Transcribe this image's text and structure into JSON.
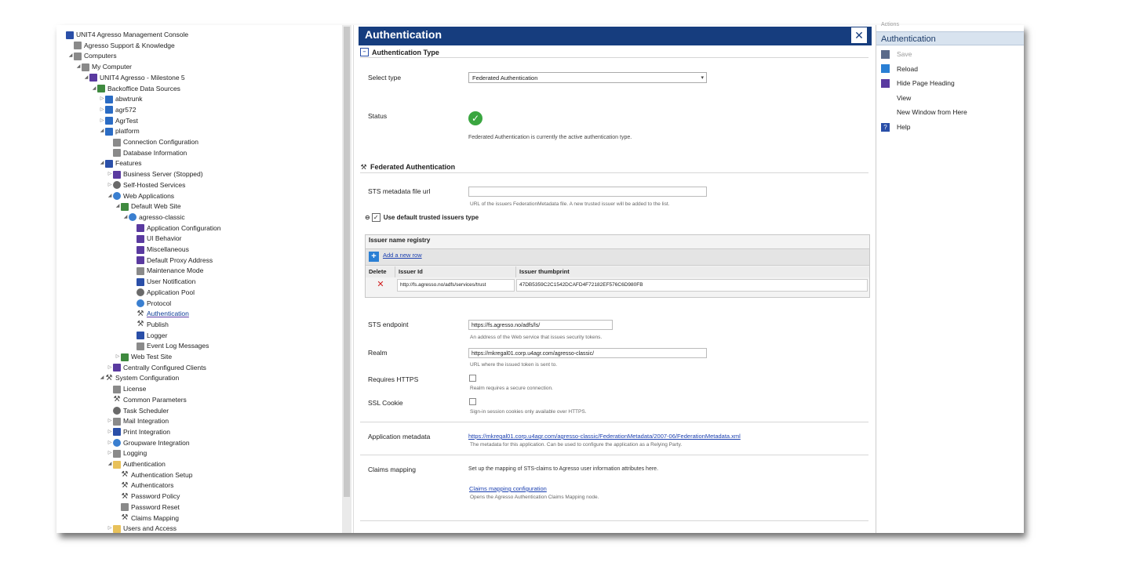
{
  "tree": [
    {
      "label": "UNIT4 Agresso Management Console",
      "level": 0,
      "tw": "",
      "icon": "console-icon",
      "ic": "blue"
    },
    {
      "label": "Agresso Support & Knowledge",
      "level": 1,
      "tw": "",
      "icon": "support-icon",
      "ic": "gray"
    },
    {
      "label": "Computers",
      "level": 1,
      "tw": "◢",
      "icon": "computers-icon",
      "ic": "gray"
    },
    {
      "label": "My Computer",
      "level": 2,
      "tw": "◢",
      "icon": "computer-icon",
      "ic": "gray"
    },
    {
      "label": "UNIT4 Agresso - Milestone 5",
      "level": 3,
      "tw": "◢",
      "icon": "agresso-icon",
      "ic": "purple"
    },
    {
      "label": "Backoffice Data Sources",
      "level": 4,
      "tw": "◢",
      "icon": "datasources-icon",
      "ic": "green"
    },
    {
      "label": "abwtrunk",
      "level": 5,
      "tw": "▷",
      "icon": "database-icon",
      "ic": "db"
    },
    {
      "label": "agr572",
      "level": 5,
      "tw": "▷",
      "icon": "database-icon",
      "ic": "db"
    },
    {
      "label": "AgrTest",
      "level": 5,
      "tw": "▷",
      "icon": "database-icon",
      "ic": "db"
    },
    {
      "label": "platform",
      "level": 5,
      "tw": "◢",
      "icon": "database-icon",
      "ic": "db"
    },
    {
      "label": "Connection Configuration",
      "level": 6,
      "tw": "",
      "icon": "connection-icon",
      "ic": "gray"
    },
    {
      "label": "Database Information",
      "level": 6,
      "tw": "",
      "icon": "info-icon",
      "ic": "gray"
    },
    {
      "label": "Features",
      "level": 5,
      "tw": "◢",
      "icon": "features-icon",
      "ic": "blue"
    },
    {
      "label": "Business Server (Stopped)",
      "level": 6,
      "tw": "▷",
      "icon": "server-icon",
      "ic": "purple"
    },
    {
      "label": "Self-Hosted Services",
      "level": 6,
      "tw": "▷",
      "icon": "services-icon",
      "ic": "gear"
    },
    {
      "label": "Web Applications",
      "level": 6,
      "tw": "◢",
      "icon": "webapps-icon",
      "ic": "globe"
    },
    {
      "label": "Default Web Site",
      "level": 7,
      "tw": "◢",
      "icon": "website-icon",
      "ic": "green"
    },
    {
      "label": "agresso-classic",
      "level": 8,
      "tw": "◢",
      "icon": "globe-icon",
      "ic": "globe"
    },
    {
      "label": "Application Configuration",
      "level": 9,
      "tw": "",
      "icon": "config-icon",
      "ic": "purple"
    },
    {
      "label": "UI Behavior",
      "level": 9,
      "tw": "",
      "icon": "ui-icon",
      "ic": "purple"
    },
    {
      "label": "Miscellaneous",
      "level": 9,
      "tw": "",
      "icon": "misc-icon",
      "ic": "purple"
    },
    {
      "label": "Default Proxy Address",
      "level": 9,
      "tw": "",
      "icon": "proxy-icon",
      "ic": "purple"
    },
    {
      "label": "Maintenance Mode",
      "level": 9,
      "tw": "",
      "icon": "maintenance-icon",
      "ic": "gray"
    },
    {
      "label": "User Notification",
      "level": 9,
      "tw": "",
      "icon": "notification-icon",
      "ic": "blue"
    },
    {
      "label": "Application Pool",
      "level": 9,
      "tw": "",
      "icon": "pool-icon",
      "ic": "gear"
    },
    {
      "label": "Protocol",
      "level": 9,
      "tw": "",
      "icon": "protocol-icon",
      "ic": "globe"
    },
    {
      "label": "Authentication",
      "level": 9,
      "tw": "",
      "icon": "authentication-icon",
      "ic": "tool",
      "selected": true
    },
    {
      "label": "Publish",
      "level": 9,
      "tw": "",
      "icon": "publish-icon",
      "ic": "tool"
    },
    {
      "label": "Logger",
      "level": 9,
      "tw": "",
      "icon": "logger-icon",
      "ic": "blue"
    },
    {
      "label": "Event Log Messages",
      "level": 9,
      "tw": "",
      "icon": "eventlog-icon",
      "ic": "gray"
    },
    {
      "label": "Web Test Site",
      "level": 7,
      "tw": "▷",
      "icon": "website-icon",
      "ic": "green"
    },
    {
      "label": "Centrally Configured Clients",
      "level": 6,
      "tw": "▷",
      "icon": "clients-icon",
      "ic": "purple"
    },
    {
      "label": "System Configuration",
      "level": 5,
      "tw": "◢",
      "icon": "sysconfig-icon",
      "ic": "tool"
    },
    {
      "label": "License",
      "level": 6,
      "tw": "",
      "icon": "license-icon",
      "ic": "gray"
    },
    {
      "label": "Common Parameters",
      "level": 6,
      "tw": "",
      "icon": "parameters-icon",
      "ic": "tool"
    },
    {
      "label": "Task Scheduler",
      "level": 6,
      "tw": "",
      "icon": "clock-icon",
      "ic": "gear"
    },
    {
      "label": "Mail Integration",
      "level": 6,
      "tw": "▷",
      "icon": "mail-icon",
      "ic": "gray"
    },
    {
      "label": "Print Integration",
      "level": 6,
      "tw": "▷",
      "icon": "print-icon",
      "ic": "blue"
    },
    {
      "label": "Groupware Integration",
      "level": 6,
      "tw": "▷",
      "icon": "groupware-icon",
      "ic": "globe"
    },
    {
      "label": "Logging",
      "level": 6,
      "tw": "▷",
      "icon": "logging-icon",
      "ic": "gray"
    },
    {
      "label": "Authentication",
      "level": 6,
      "tw": "◢",
      "icon": "folder-icon",
      "ic": "folder"
    },
    {
      "label": "Authentication Setup",
      "level": 7,
      "tw": "",
      "icon": "setup-icon",
      "ic": "tool"
    },
    {
      "label": "Authenticators",
      "level": 7,
      "tw": "",
      "icon": "authenticators-icon",
      "ic": "tool"
    },
    {
      "label": "Password Policy",
      "level": 7,
      "tw": "",
      "icon": "policy-icon",
      "ic": "tool"
    },
    {
      "label": "Password Reset",
      "level": 7,
      "tw": "",
      "icon": "reset-icon",
      "ic": "gray"
    },
    {
      "label": "Claims Mapping",
      "level": 7,
      "tw": "",
      "icon": "claims-icon",
      "ic": "tool"
    },
    {
      "label": "Users and Access",
      "level": 6,
      "tw": "▷",
      "icon": "folder-icon",
      "ic": "folder"
    }
  ],
  "header": {
    "title": "Authentication"
  },
  "auth_type": {
    "section": "Authentication Type",
    "select_label": "Select type",
    "select_value": "Federated Authentication",
    "status_label": "Status",
    "status_text": "Federated Authentication is currently the active authentication type."
  },
  "federated": {
    "section": "Federated Authentication",
    "sts_meta_label": "STS metadata file url",
    "sts_meta_value": "",
    "sts_meta_hint": "URL of the issuers FederationMetadata file. A new trusted issuer will be added to the list.",
    "use_default_label": "Use default trusted issuers type",
    "registry": {
      "title": "Issuer name registry",
      "add_row": "Add a new row",
      "columns": [
        "Delete",
        "Issuer Id",
        "Issuer thumbprint"
      ],
      "rows": [
        {
          "delete": "✕",
          "issuer_id": "http://fs.agresso.no/adfs/services/trust",
          "thumbprint": "47DB5359C2C1542DCAFD4F72182EF576C6D980FB"
        }
      ]
    },
    "sts_endpoint_label": "STS endpoint",
    "sts_endpoint_value": "https://fs.agresso.no/adfs/ls/",
    "sts_endpoint_hint": "An address of the Web service that issues security tokens.",
    "realm_label": "Realm",
    "realm_value": "https://mkregal01.corp.u4agr.com/agresso-classic/",
    "realm_hint": "URL where the issued token is sent to.",
    "https_label": "Requires HTTPS",
    "https_hint": "Realm requires a secure connection.",
    "ssl_label": "SSL Cookie",
    "ssl_hint": "Sign-in session cookies only available over HTTPS.",
    "appmeta_label": "Application metadata",
    "appmeta_link": "https://mkregal01.corp.u4agr.com/agresso-classic/FederationMetadata/2007-06/FederationMetadata.xml",
    "appmeta_hint": "The metadata for this application. Can be used to configure the application as a Relying Party.",
    "claims_label": "Claims mapping",
    "claims_text": "Set up the mapping of STS-claims to Agresso user information attributes here.",
    "claims_link": "Claims mapping configuration",
    "claims_hint": "Opens the Agresso Authentication Claims Mapping node."
  },
  "actions": {
    "top_label": "Actions",
    "title": "Authentication",
    "items": [
      {
        "label": "Save",
        "icon": "save-icon",
        "color": "#5a6a8a",
        "disabled": true
      },
      {
        "label": "Reload",
        "icon": "reload-icon",
        "color": "#2a7fd4",
        "disabled": false
      },
      {
        "label": "Hide Page Heading",
        "icon": "heading-icon",
        "color": "#5a3aa0",
        "disabled": false
      },
      {
        "label": "View",
        "icon": "",
        "color": "",
        "disabled": false
      },
      {
        "label": "New Window from Here",
        "icon": "",
        "color": "",
        "disabled": false
      },
      {
        "label": "Help",
        "icon": "help-icon",
        "color": "#2a4fa8",
        "disabled": false
      }
    ]
  }
}
